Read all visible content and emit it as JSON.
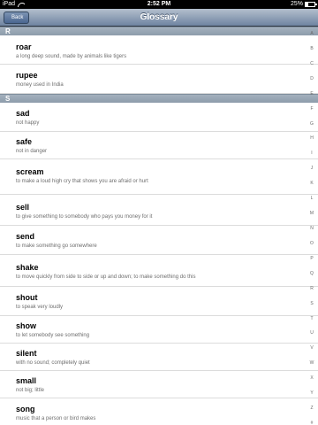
{
  "status_bar": {
    "carrier": "iPad",
    "time": "2:52 PM",
    "battery_text": "25%",
    "battery_level": 0.25
  },
  "nav": {
    "back_label": "Back",
    "title": "Glossary"
  },
  "sections": [
    {
      "header": "R",
      "rows": [
        {
          "word": "roar",
          "meaning": "a long deep sound, made by animals like tigers"
        },
        {
          "word": "rupee",
          "meaning": "money used in India"
        }
      ]
    },
    {
      "header": "S",
      "rows": [
        {
          "word": "sad",
          "meaning": "not happy"
        },
        {
          "word": "safe",
          "meaning": "not in danger"
        },
        {
          "word": "scream",
          "meaning": "to make a loud high cry that shows you are afraid or hurt"
        },
        {
          "word": "sell",
          "meaning": "to give something to somebody who pays you money for it"
        },
        {
          "word": "send",
          "meaning": "to make something go somewhere"
        },
        {
          "word": "shake",
          "meaning": "to move quickly from side to side or up and down; to make something do this"
        },
        {
          "word": "shout",
          "meaning": "to speak very loudly"
        },
        {
          "word": "show",
          "meaning": "to let somebody see something"
        },
        {
          "word": "silent",
          "meaning": "with no sound; completely quiet"
        },
        {
          "word": "small",
          "meaning": "not big; little"
        },
        {
          "word": "song",
          "meaning": "music that a person or bird makes"
        }
      ]
    }
  ],
  "index_letters": [
    "A",
    "B",
    "C",
    "D",
    "E",
    "F",
    "G",
    "H",
    "I",
    "J",
    "K",
    "L",
    "M",
    "N",
    "O",
    "P",
    "Q",
    "R",
    "S",
    "T",
    "U",
    "V",
    "W",
    "X",
    "Y",
    "Z",
    "#"
  ]
}
